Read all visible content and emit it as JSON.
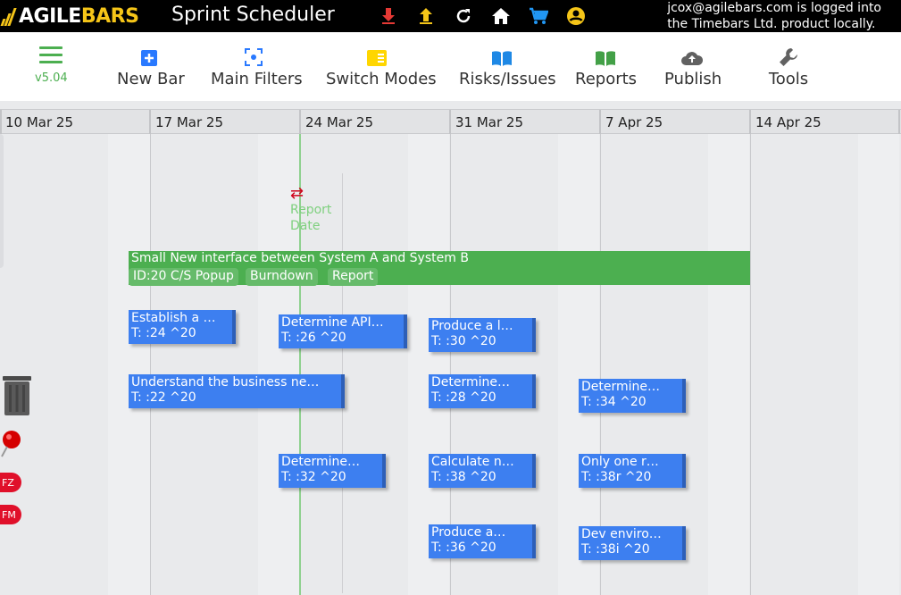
{
  "brand": {
    "agile": "AGILE",
    "bars": "BARS",
    "logo_letters": "AB"
  },
  "app_title": "Sprint Scheduler",
  "top_icons": [
    "download-icon",
    "upload-icon",
    "refresh-icon",
    "home-icon",
    "cart-icon",
    "account-icon"
  ],
  "login": {
    "line1": "jcox@agilebars.com is logged into",
    "line2": "the Timebars Ltd. product locally."
  },
  "colors": {
    "accent_green": "#4caf50",
    "bar_blue": "#3d7ff0",
    "header_black": "#000000",
    "brand_yellow": "#f5c518",
    "alert_red": "#e0102a"
  },
  "menu": {
    "icon": "hamburger-menu-icon",
    "version": "v5.04"
  },
  "toolbar": [
    {
      "label": "New Bar",
      "icon": "plus-square-icon"
    },
    {
      "label": "Main Filters",
      "icon": "focus-filter-icon"
    },
    {
      "label": "Switch Modes",
      "icon": "switch-modes-icon"
    },
    {
      "label": "Risks/Issues",
      "icon": "open-book-icon"
    },
    {
      "label": "Reports",
      "icon": "reports-book-icon"
    },
    {
      "label": "Publish",
      "icon": "cloud-upload-icon"
    },
    {
      "label": "Tools",
      "icon": "wrench-icon"
    }
  ],
  "weeks": [
    "10 Mar 25",
    "17 Mar 25",
    "24 Mar 25",
    "31 Mar 25",
    "7 Apr 25",
    "14 Apr 25"
  ],
  "report_date": {
    "line1": "Report",
    "line2": "Date"
  },
  "summary": {
    "title": "Small New interface between System A and System B",
    "chips": [
      "ID:20 C/S Popup",
      "Burndown",
      "Report"
    ]
  },
  "tasks": [
    {
      "title": "Establish a …",
      "sub": "T: :24 ^20"
    },
    {
      "title": "Determine API…",
      "sub": "T: :26 ^20"
    },
    {
      "title": "Produce a l…",
      "sub": "T: :30 ^20"
    },
    {
      "title": "Understand the business ne…",
      "sub": "T: :22 ^20"
    },
    {
      "title": "Determine…",
      "sub": "T: :28 ^20"
    },
    {
      "title": "Determine…",
      "sub": "T: :34 ^20"
    },
    {
      "title": "Determine…",
      "sub": "T: :32 ^20"
    },
    {
      "title": "Calculate n…",
      "sub": "T: :38 ^20"
    },
    {
      "title": "Only one r…",
      "sub": "T: :38r ^20"
    },
    {
      "title": "Produce a…",
      "sub": "T: :36 ^20"
    },
    {
      "title": "Dev enviro…",
      "sub": "T: :38i ^20"
    }
  ],
  "side_tags": [
    "FZ",
    "FM"
  ]
}
